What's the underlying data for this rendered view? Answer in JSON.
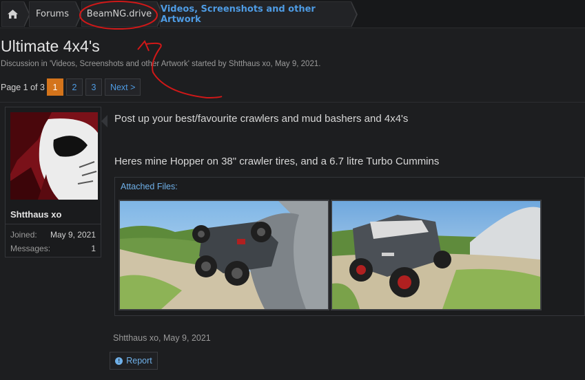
{
  "breadcrumb": {
    "home_icon": "home-icon",
    "items": [
      "Forums",
      "BeamNG.drive",
      "Videos, Screenshots and other Artwork"
    ]
  },
  "thread": {
    "title": "Ultimate 4x4's",
    "subtitle": "Discussion in 'Videos, Screenshots and other Artwork' started by Shtthaus xo, May 9, 2021."
  },
  "pager": {
    "label": "Page 1 of 3",
    "pages": [
      "1",
      "2",
      "3"
    ],
    "current": "1",
    "next": "Next >"
  },
  "user": {
    "name": "Shtthaus xo",
    "joined_label": "Joined:",
    "joined_value": "May 9, 2021",
    "messages_label": "Messages:",
    "messages_value": "1"
  },
  "post": {
    "line1": "Post up your best/favourite crawlers and mud bashers and 4x4's",
    "line2": "Heres mine Hopper on 38\" crawler tires, and a 6.7 litre Turbo Cummins",
    "attached_label": "Attached Files:",
    "meta": "Shtthaus xo, May 9, 2021",
    "report_label": "Report"
  },
  "colors": {
    "accent_blue": "#4e9be3",
    "current_page": "#d4741b",
    "annotation_red": "#d01818"
  }
}
